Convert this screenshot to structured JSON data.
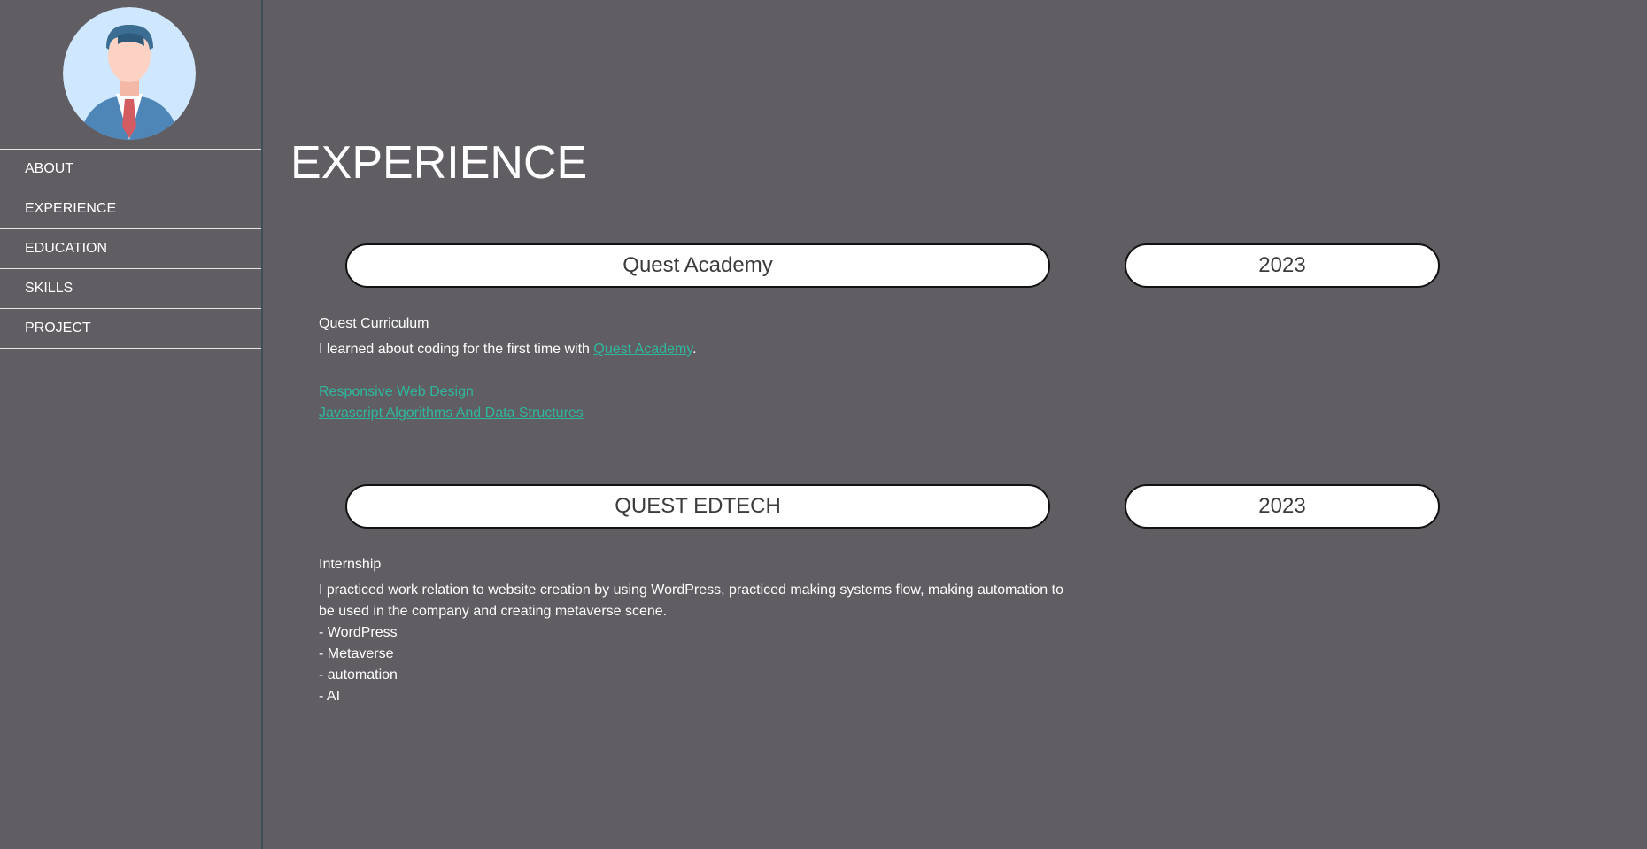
{
  "sidebar": {
    "avatar_icon": "businessman-avatar-icon",
    "items": [
      {
        "label": "ABOUT"
      },
      {
        "label": "EXPERIENCE"
      },
      {
        "label": "EDUCATION"
      },
      {
        "label": "SKILLS"
      },
      {
        "label": "PROJECT"
      }
    ]
  },
  "page": {
    "title": "EXPERIENCE"
  },
  "experiences": [
    {
      "organization": "Quest Academy",
      "year": "2023",
      "role": "Quest Curriculum",
      "description_prefix": "I learned about coding for the first time with ",
      "description_link": "Quest Academy",
      "description_suffix": ".",
      "links": [
        "Responsive Web Design",
        "Javascript Algorithms And Data Structures"
      ]
    },
    {
      "organization": "QUEST EDTECH",
      "year": "2023",
      "role": "Internship",
      "description": "I practiced work relation to website creation by using WordPress, practiced making systems flow, making automation to be used in the company and creating metaverse scene.",
      "bullets": [
        "- WordPress",
        "- Metaverse",
        "- automation",
        "- AI"
      ]
    }
  ],
  "colors": {
    "background": "#605d63",
    "link": "#2fb79d",
    "pill_background": "#ffffff",
    "pill_text": "#3c3c3c"
  }
}
